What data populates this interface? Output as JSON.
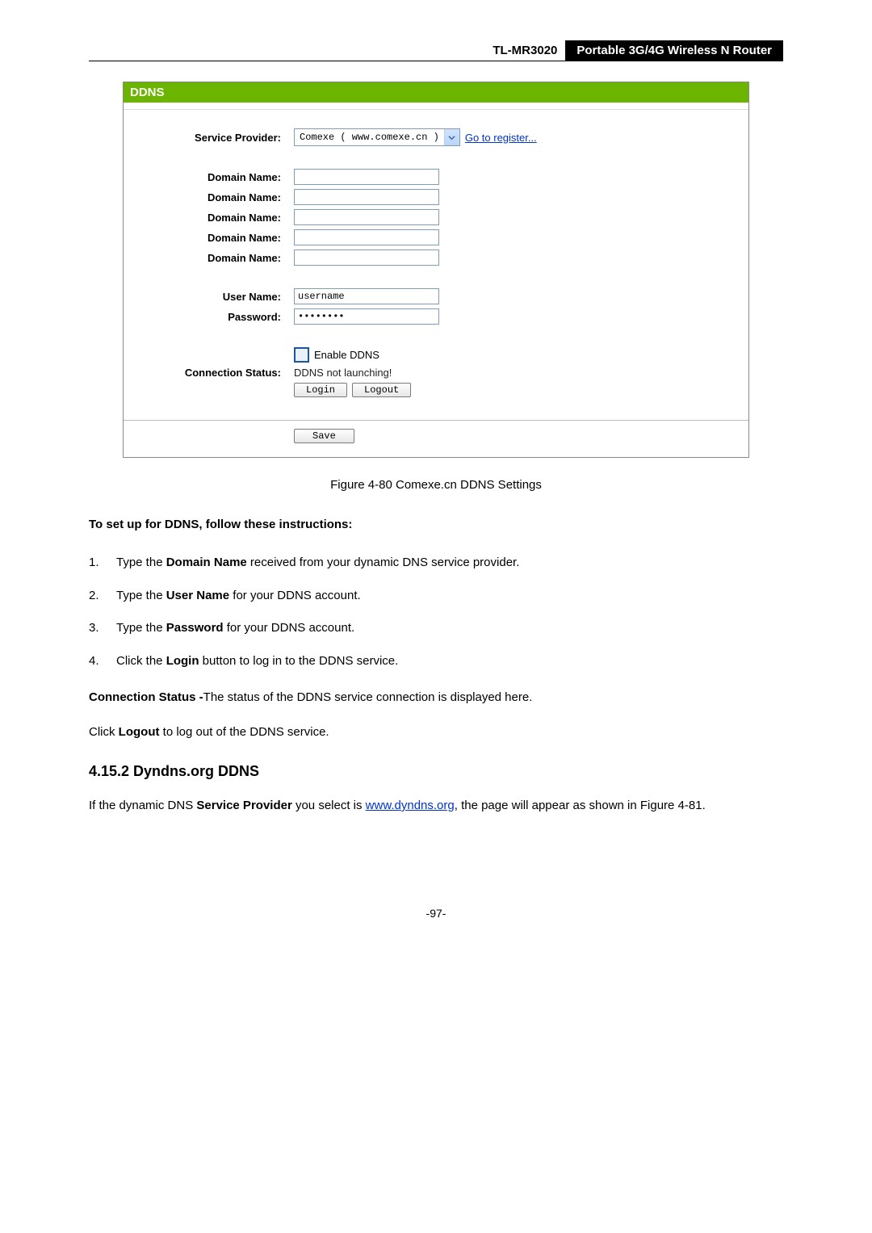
{
  "header": {
    "model": "TL-MR3020",
    "product": "Portable 3G/4G Wireless N Router"
  },
  "panel": {
    "title": "DDNS",
    "labels": {
      "service_provider": "Service Provider:",
      "domain_name": "Domain Name:",
      "user_name": "User Name:",
      "password": "Password:",
      "connection_status": "Connection Status:",
      "enable_ddns": "Enable DDNS"
    },
    "values": {
      "provider_option": "Comexe ( www.comexe.cn )",
      "register_link": "Go to register...",
      "username": "username",
      "password_masked": "••••••••",
      "connection_status_text": "DDNS not launching!"
    },
    "buttons": {
      "login": "Login",
      "logout": "Logout",
      "save": "Save"
    }
  },
  "caption": "Figure 4-80 Comexe.cn DDNS Settings",
  "instructions": {
    "heading": "To set up for DDNS, follow these instructions:",
    "items": [
      {
        "num": "1.",
        "pre": "Type the ",
        "bold": "Domain Name",
        "post": " received from your dynamic DNS service provider."
      },
      {
        "num": "2.",
        "pre": "Type the ",
        "bold": "User Name",
        "post": " for your DDNS account."
      },
      {
        "num": "3.",
        "pre": "Type the ",
        "bold": "Password",
        "post": " for your DDNS account."
      },
      {
        "num": "4.",
        "pre": "Click the ",
        "bold": "Login",
        "post": " button to log in to the DDNS service."
      }
    ]
  },
  "conn_status_para": {
    "bold": "Connection Status -",
    "rest": "The status of the DDNS service connection is displayed here."
  },
  "logout_para": {
    "pre": "Click ",
    "bold": "Logout",
    "post": " to log out of the DDNS service."
  },
  "section": {
    "heading": "4.15.2  Dyndns.org DDNS",
    "para_pre": "If the dynamic DNS ",
    "para_bold": "Service Provider",
    "para_mid": " you select is ",
    "para_link": "www.dyndns.org",
    "para_post": ", the page will appear as shown in Figure 4-81."
  },
  "page_number": "-97-"
}
